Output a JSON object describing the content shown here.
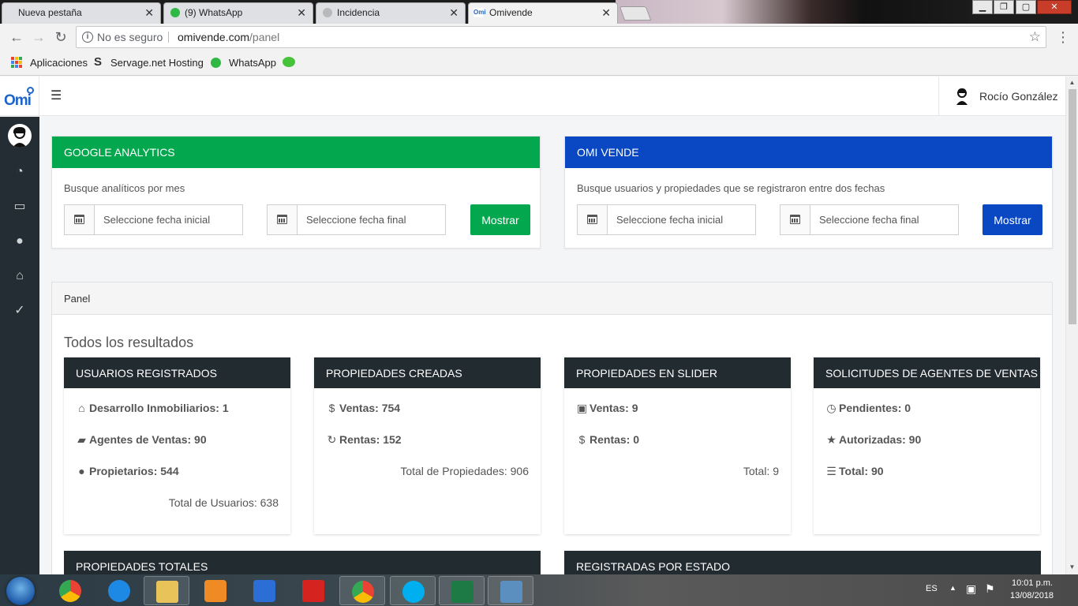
{
  "browser": {
    "tabs": [
      {
        "title": "Nueva pestaña",
        "active": false
      },
      {
        "title": "(9) WhatsApp",
        "active": false
      },
      {
        "title": "Incidencia",
        "active": false
      },
      {
        "title": "Omivende",
        "active": true
      }
    ],
    "address": {
      "security": "No es seguro",
      "domain": "omivende.com",
      "path": "/panel"
    },
    "bookmarks": [
      {
        "label": "Aplicaciones",
        "icon": "apps-grid-icon"
      },
      {
        "label": "Servage.net Hosting",
        "icon": "servage-icon"
      },
      {
        "label": "WhatsApp",
        "icon": "whatsapp-icon"
      },
      {
        "label": "",
        "icon": "wechat-icon"
      }
    ]
  },
  "app": {
    "logo": "Omi",
    "user_name": "Rocío González",
    "sidebar": [
      {
        "icon": "dashboard-icon",
        "glyph": "◔"
      },
      {
        "icon": "monitor-icon",
        "glyph": "▭"
      },
      {
        "icon": "user-icon",
        "glyph": "●"
      },
      {
        "icon": "home-icon",
        "glyph": "⌂"
      },
      {
        "icon": "check-circle-icon",
        "glyph": "✓"
      }
    ]
  },
  "analytics": {
    "title": "GOOGLE ANALYTICS",
    "description": "Busque analíticos por mes",
    "start_placeholder": "Seleccione fecha inicial",
    "end_placeholder": "Seleccione fecha final",
    "button": "Mostrar",
    "color": "#03a84e"
  },
  "omivende": {
    "title": "OMI VENDE",
    "description": "Busque usuarios y propiedades que se registraron entre dos fechas",
    "start_placeholder": "Seleccione fecha inicial",
    "end_placeholder": "Seleccione fecha final",
    "button": "Mostrar",
    "color": "#0a47c2"
  },
  "panel": {
    "title": "Panel",
    "subtitle": "Todos los resultados",
    "cards": [
      {
        "title": "USUARIOS REGISTRADOS",
        "rows": [
          {
            "icon": "home-icon",
            "glyph": "⌂",
            "text": "Desarrollo Inmobiliarios: 1"
          },
          {
            "icon": "briefcase-icon",
            "glyph": "▰",
            "text": "Agentes de Ventas: 90"
          },
          {
            "icon": "user-icon",
            "glyph": "●",
            "text": "Propietarios: 544"
          }
        ],
        "total": "Total de Usuarios: 638"
      },
      {
        "title": "PROPIEDADES CREADAS",
        "rows": [
          {
            "icon": "dollar-icon",
            "glyph": "$",
            "text": "Ventas: 754"
          },
          {
            "icon": "refresh-icon",
            "glyph": "↻",
            "text": "Rentas: 152"
          }
        ],
        "total": "Total de Propiedades: 906"
      },
      {
        "title": "PROPIEDADES EN SLIDER",
        "rows": [
          {
            "icon": "picture-icon",
            "glyph": "▣",
            "text": "Ventas: 9"
          },
          {
            "icon": "dollar-icon",
            "glyph": "$",
            "text": "Rentas: 0"
          }
        ],
        "total": "Total: 9"
      },
      {
        "title": "SOLICITUDES DE AGENTES DE VENTAS",
        "rows": [
          {
            "icon": "clock-icon",
            "glyph": "◷",
            "text": "Pendientes: 0"
          },
          {
            "icon": "star-icon",
            "glyph": "★",
            "text": "Autorizadas: 90"
          },
          {
            "icon": "list-icon",
            "glyph": "☰",
            "text": "Total: 90"
          }
        ],
        "total": ""
      }
    ],
    "bottom_cards": [
      "PROPIEDADES TOTALES",
      "REGISTRADAS POR ESTADO"
    ]
  },
  "taskbar": {
    "language": "ES",
    "time": "10:01 p.m.",
    "date": "13/08/2018",
    "apps": [
      "chrome-icon",
      "ie-icon",
      "explorer-icon",
      "media-player-icon",
      "sublime-icon",
      "acrobat-icon",
      "chrome-icon",
      "skype-icon",
      "excel-icon",
      "image-viewer-icon"
    ]
  }
}
